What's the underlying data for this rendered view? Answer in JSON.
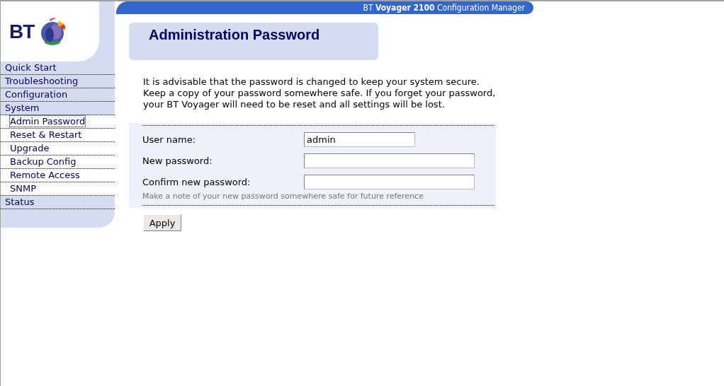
{
  "logo": {
    "text": "BT"
  },
  "banner": {
    "title": "BT **Voyager 2100** Configuration Manager"
  },
  "menu": [
    {
      "label": "Quick Start",
      "selected": false
    },
    {
      "label": "Troubleshooting",
      "selected": false
    },
    {
      "label": "Configuration",
      "selected": false
    },
    {
      "label": "System",
      "selected": false,
      "children": [
        {
          "label": "Admin Password",
          "selected": true
        },
        {
          "label": "Reset & Restart",
          "selected": false
        },
        {
          "label": "Upgrade",
          "selected": false
        },
        {
          "label": "Backup Config",
          "selected": false
        },
        {
          "label": "Remote Access",
          "selected": false
        },
        {
          "label": "SNMP",
          "selected": false
        }
      ]
    },
    {
      "label": "Status",
      "selected": false
    }
  ],
  "page": {
    "title": "Administration Password",
    "intro": [
      "It is advisable that the password is changed to keep your system secure.",
      "Keep a copy of your password somewhere safe. If you forget your password,",
      "your BT Voyager will need to be reset and all settings will be lost."
    ]
  },
  "form": {
    "fields": [
      {
        "label": "User name:",
        "value": "admin",
        "kind": "short"
      },
      {
        "label": "New password:",
        "kind": "long"
      },
      {
        "label": "Confirm new password:",
        "kind": "long"
      }
    ],
    "note": "Make a note of your new password somewhere safe for future reference",
    "button": "Apply"
  }
}
